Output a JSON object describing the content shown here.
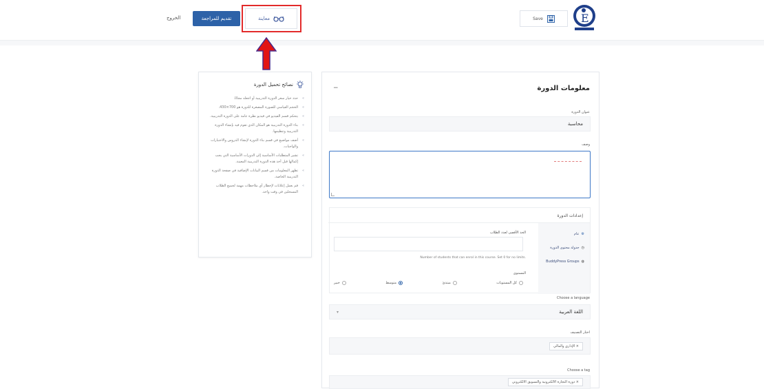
{
  "header": {
    "logout_label": "الخروج",
    "submit_label": "تقديم للمراجعة",
    "preview_label": "معاينة",
    "save_label": "Save"
  },
  "tips": {
    "title": "نصائح تحميل الدورة",
    "items": [
      "حدد خيار سعر الدورة التدريبية أو اجعله مجانًا.",
      "الحجم القياسي للصورة المصغرة للدورة هو 700×430.",
      "يتحكم قسم الفيديو في فيديو نظرة عامة على الدورة التدريبية.",
      "بناء الدورة التدريبية هو المكان الذي تقوم فيه بإنشاء الدورة التدريبية وتنظيمها.",
      "أضف مواضيع في قسم بناء الدورة لإنشاء الدروس والاختبارات والواجبات.",
      "تشير المتطلبات الأساسية إلى الدورات الأساسية التي يجب إكمالها قبل أخذ هذه الدورة التدريبية المعينة.",
      "تظهر المعلومات من قسم البيانات الإضافية في صفحة الدورة التدريبية الخاصة.",
      "قم بعمل إعلانات لإخطار أي ملاحظات مهمة لجميع الطلاب المسجلين في وقت واحد."
    ]
  },
  "course": {
    "section_title": "معلومات الدورة",
    "collapse_symbol": "−",
    "title_label": "عنوان الدورة",
    "title_value": "محاسبة",
    "description_label": "وصف",
    "settings": {
      "heading": "إعدادات الدورة",
      "side_items": [
        "عام",
        "جدولة محتوى الدورة",
        "BuddyPress Groups"
      ],
      "max_students_label": "الحد الأقصى لعدد الطلاب",
      "max_students_help": "Number of students that can enrol in this course. Set 0 for no limits.",
      "level_label": "المستوى",
      "levels": [
        "كل المستويات",
        "مبتدئ",
        "متوسط",
        "خبير"
      ],
      "selected_level": "متوسط"
    },
    "language_label": "Choose a language",
    "language_value": "اللغة العربية",
    "category_label": "اختار التصنيف",
    "category_tag": "× الإداري والمالي",
    "tag_label": "Choose a tag",
    "tag_value": "× دورة التجارة الالكترونية والتسويق الالكتروني"
  },
  "colors": {
    "primary": "#2d62a8",
    "highlight": "#e22a2a"
  }
}
